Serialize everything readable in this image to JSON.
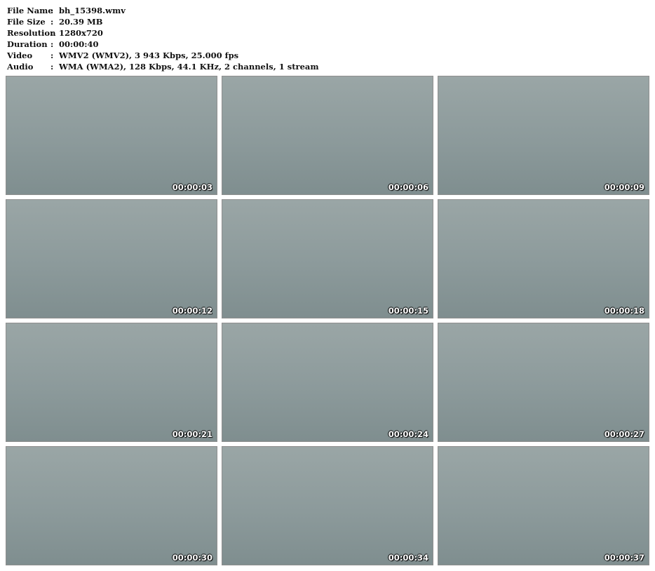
{
  "info": {
    "rows": [
      {
        "key": "File Name",
        "value": "bh_15398.wmv"
      },
      {
        "key": "File Size",
        "value": "20.39 MB"
      },
      {
        "key": "Resolution",
        "value": "1280x720"
      },
      {
        "key": "Duration",
        "value": "00:00:40"
      },
      {
        "key": "Video",
        "value": "WMV2 (WMV2), 3 943 Kbps, 25.000 fps"
      },
      {
        "key": "Audio",
        "value": "WMA (WMA2), 128 Kbps, 44.1 KHz, 2 channels, 1 stream"
      }
    ],
    "separator": ":"
  },
  "frames": [
    {
      "timestamp": "00:00:03"
    },
    {
      "timestamp": "00:00:06"
    },
    {
      "timestamp": "00:00:09"
    },
    {
      "timestamp": "00:00:12"
    },
    {
      "timestamp": "00:00:15"
    },
    {
      "timestamp": "00:00:18"
    },
    {
      "timestamp": "00:00:21"
    },
    {
      "timestamp": "00:00:24"
    },
    {
      "timestamp": "00:00:27"
    },
    {
      "timestamp": "00:00:30"
    },
    {
      "timestamp": "00:00:34"
    },
    {
      "timestamp": "00:00:37"
    }
  ]
}
